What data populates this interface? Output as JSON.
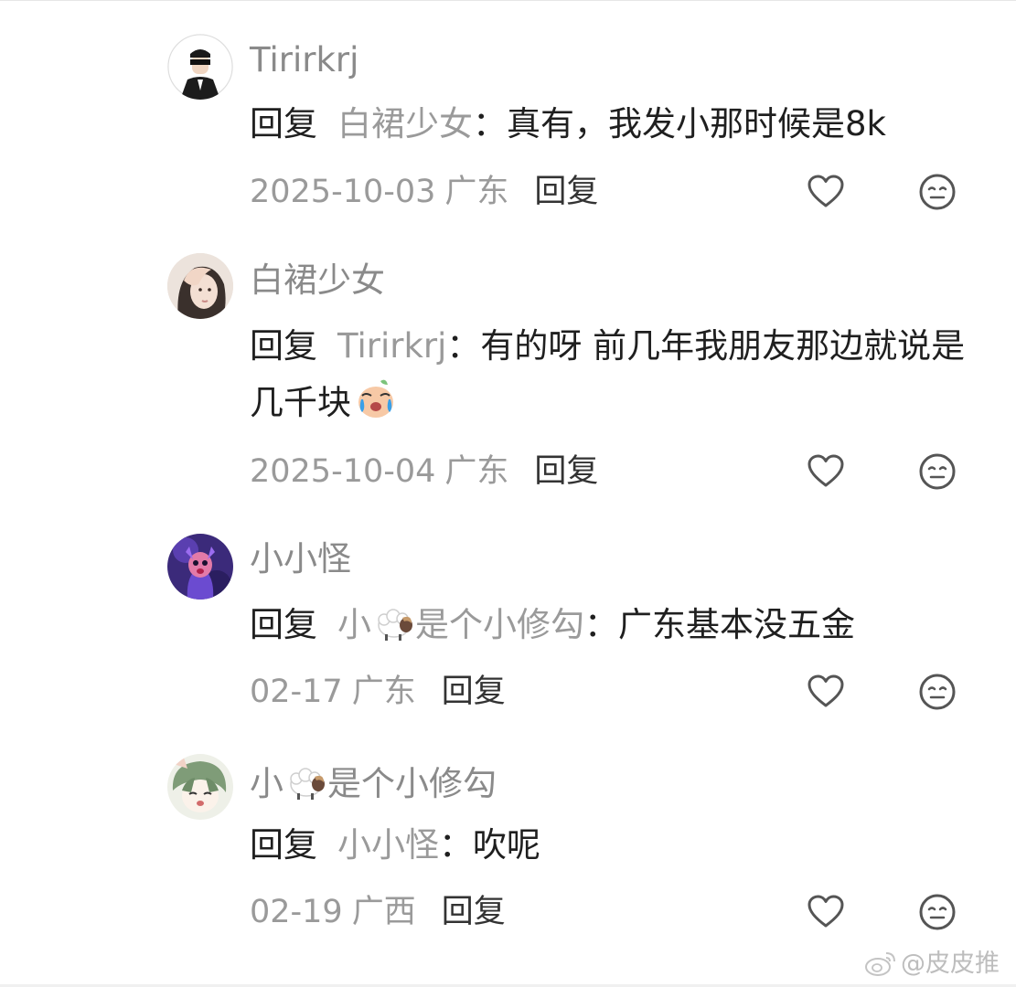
{
  "comments": [
    {
      "username": "Tirirkrj",
      "reply_label": "回复",
      "target": "白裙少女",
      "colon": "：",
      "text": "真有，我发小那时候是8k",
      "date": "2025-10-03",
      "location": "广东",
      "reply_button": "回复"
    },
    {
      "username": "白裙少女",
      "reply_label": "回复",
      "target": "Tirirkrj",
      "colon": "：",
      "text": "有的呀 前几年我朋友那边就说是几千块",
      "emoji": "crying-face-emoji",
      "date": "2025-10-04",
      "location": "广东",
      "reply_button": "回复"
    },
    {
      "username": "小小怪",
      "reply_label": "回复",
      "target_prefix": "小",
      "target_suffix": "是个小修勾",
      "target_emoji": "sheep-emoji",
      "colon": "：",
      "text": "广东基本没五金",
      "date": "02-17",
      "location": "广东",
      "reply_button": "回复"
    },
    {
      "username_prefix": "小",
      "username_suffix": "是个小修勾",
      "username_emoji": "sheep-emoji",
      "reply_label": "回复",
      "target": "小小怪",
      "colon": "：",
      "text": "吹呢",
      "date": "02-19",
      "location": "广西",
      "reply_button": "回复"
    }
  ],
  "watermark": {
    "text": "@皮皮推",
    "icon": "weibo-logo-icon"
  },
  "icons": {
    "like": "heart-outline-icon",
    "dislike": "neutral-face-icon"
  },
  "colors": {
    "username": "#8a8a8a",
    "meta": "#9a9a9a",
    "text": "#1f1f1f",
    "icon": "#555555"
  }
}
